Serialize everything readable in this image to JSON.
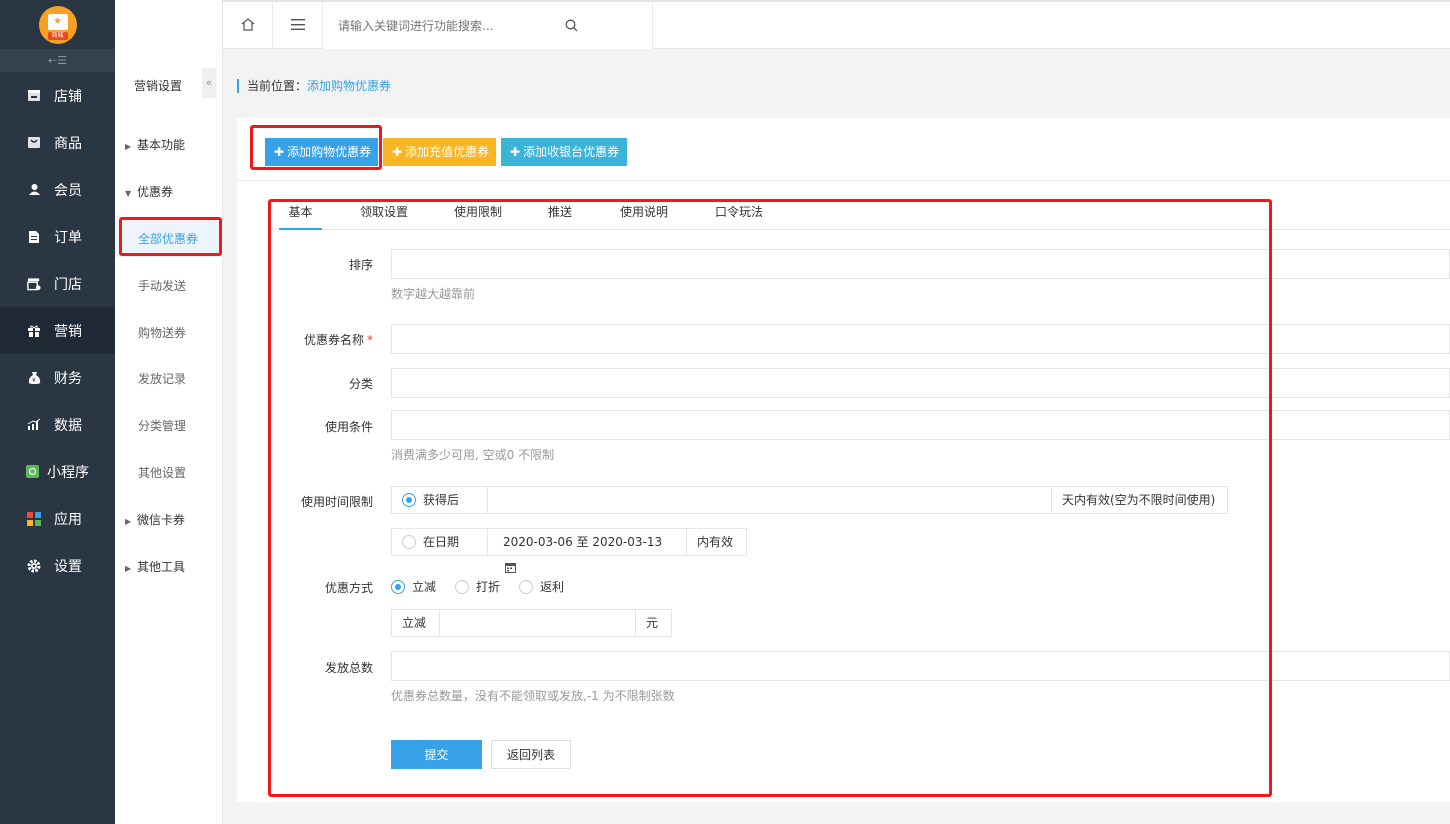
{
  "logo": {
    "tag": "商城"
  },
  "sidebar": {
    "collapse": "⇠☰",
    "items": [
      {
        "label": "店铺",
        "icon": "shop-icon"
      },
      {
        "label": "商品",
        "icon": "goods-icon"
      },
      {
        "label": "会员",
        "icon": "member-icon"
      },
      {
        "label": "订单",
        "icon": "order-icon"
      },
      {
        "label": "门店",
        "icon": "store-icon"
      },
      {
        "label": "营销",
        "icon": "gift-icon"
      },
      {
        "label": "财务",
        "icon": "money-bag-icon"
      },
      {
        "label": "数据",
        "icon": "chart-icon"
      },
      {
        "label": "小程序",
        "icon": "miniprogram-icon"
      },
      {
        "label": "应用",
        "icon": "apps-icon"
      },
      {
        "label": "设置",
        "icon": "gear-icon"
      }
    ],
    "active": "营销"
  },
  "subnav": {
    "title": "营销设置",
    "collapse": "«",
    "items": [
      {
        "label": "基本功能",
        "group": true,
        "arrow": "▶"
      },
      {
        "label": "优惠券",
        "group": true,
        "arrow": "▼"
      },
      {
        "label": "全部优惠券",
        "active": true
      },
      {
        "label": "手动发送"
      },
      {
        "label": "购物送券"
      },
      {
        "label": "发放记录"
      },
      {
        "label": "分类管理"
      },
      {
        "label": "其他设置"
      },
      {
        "label": "微信卡券",
        "group": true,
        "arrow": "▶"
      },
      {
        "label": "其他工具",
        "group": true,
        "arrow": "▶"
      }
    ]
  },
  "topbar": {
    "search_placeholder": "请输入关键词进行功能搜索..."
  },
  "breadcrumb": {
    "prefix": "当前位置：",
    "current": "添加购物优惠券"
  },
  "actions": {
    "add_shopping": "添加购物优惠券",
    "add_recharge": "添加充值优惠券",
    "add_cashier": "添加收银台优惠券"
  },
  "tabs": [
    "基本",
    "领取设置",
    "使用限制",
    "推送",
    "使用说明",
    "口令玩法"
  ],
  "form": {
    "sort_label": "排序",
    "sort_help": "数字越大越靠前",
    "name_label": "优惠券名称",
    "name_required": "*",
    "category_label": "分类",
    "condition_label": "使用条件",
    "condition_help": "消费满多少可用, 空或0 不限制",
    "time_label": "使用时间限制",
    "time_opt_after": "获得后",
    "time_after_suffix": "天内有效(空为不限时间使用)",
    "time_opt_date": "在日期",
    "date_range": "2020-03-06 至 2020-03-13",
    "date_suffix": "内有效",
    "discount_label": "优惠方式",
    "discount_opts": [
      "立减",
      "打折",
      "返利"
    ],
    "discount_prefix": "立减",
    "discount_unit": "元",
    "total_label": "发放总数",
    "total_help": "优惠券总数量，没有不能领取或发放,-1 为不限制张数",
    "submit": "提交",
    "back": "返回列表"
  },
  "colors": {
    "accent": "#38a2e8",
    "sidebar": "#2b3643",
    "yellow": "#f8b624",
    "cyan": "#3bb4d8",
    "annotation": "#f01818"
  }
}
